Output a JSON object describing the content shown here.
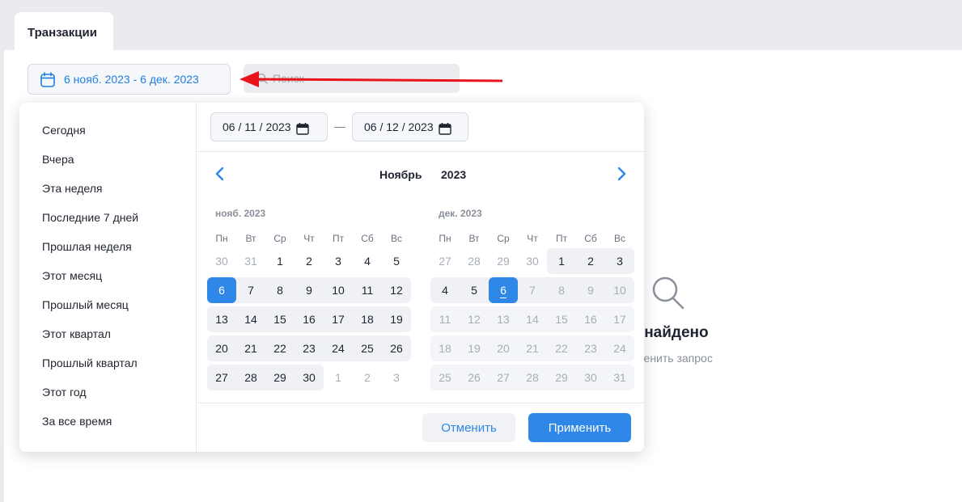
{
  "tab": {
    "label": "Транзакции"
  },
  "filter": {
    "date_range": "6 нояб. 2023 - 6 дек. 2023"
  },
  "search": {
    "placeholder": "Поиск"
  },
  "empty": {
    "title": "о не найдено",
    "subtitle": "е изменить запрос"
  },
  "presets": [
    "Сегодня",
    "Вчера",
    "Эта неделя",
    "Последние 7 дней",
    "Прошлая неделя",
    "Этот месяц",
    "Прошлый месяц",
    "Этот квартал",
    "Прошлый квартал",
    "Этот год",
    "За все время"
  ],
  "picker": {
    "start": "06 / 11 / 2023",
    "end": "06 / 12 / 2023",
    "month": "Ноябрь",
    "year": "2023",
    "weekdays": [
      "Пн",
      "Вт",
      "Ср",
      "Чт",
      "Пт",
      "Сб",
      "Вс"
    ],
    "months": [
      {
        "title": "нояб. 2023",
        "weeks": [
          [
            {
              "d": "30",
              "dim": true
            },
            {
              "d": "31",
              "dim": true
            },
            {
              "d": "1"
            },
            {
              "d": "2"
            },
            {
              "d": "3"
            },
            {
              "d": "4"
            },
            {
              "d": "5"
            }
          ],
          [
            {
              "d": "6",
              "sel": true,
              "range": true
            },
            {
              "d": "7",
              "range": true
            },
            {
              "d": "8",
              "range": true
            },
            {
              "d": "9",
              "range": true
            },
            {
              "d": "10",
              "range": true
            },
            {
              "d": "11",
              "range": true
            },
            {
              "d": "12",
              "range": true
            }
          ],
          [
            {
              "d": "13",
              "range": true
            },
            {
              "d": "14",
              "range": true
            },
            {
              "d": "15",
              "range": true
            },
            {
              "d": "16",
              "range": true
            },
            {
              "d": "17",
              "range": true
            },
            {
              "d": "18",
              "range": true
            },
            {
              "d": "19",
              "range": true
            }
          ],
          [
            {
              "d": "20",
              "range": true
            },
            {
              "d": "21",
              "range": true
            },
            {
              "d": "22",
              "range": true
            },
            {
              "d": "23",
              "range": true
            },
            {
              "d": "24",
              "range": true
            },
            {
              "d": "25",
              "range": true
            },
            {
              "d": "26",
              "range": true
            }
          ],
          [
            {
              "d": "27",
              "range": true
            },
            {
              "d": "28",
              "range": true
            },
            {
              "d": "29",
              "range": true
            },
            {
              "d": "30",
              "range": true
            },
            {
              "d": "1",
              "dim": true
            },
            {
              "d": "2",
              "dim": true
            },
            {
              "d": "3",
              "dim": true
            }
          ]
        ]
      },
      {
        "title": "дек. 2023",
        "weeks": [
          [
            {
              "d": "27",
              "dim": true
            },
            {
              "d": "28",
              "dim": true
            },
            {
              "d": "29",
              "dim": true
            },
            {
              "d": "30",
              "dim": true
            },
            {
              "d": "1",
              "range": true
            },
            {
              "d": "2",
              "range": true
            },
            {
              "d": "3",
              "range": true
            }
          ],
          [
            {
              "d": "4",
              "range": true
            },
            {
              "d": "5",
              "range": true
            },
            {
              "d": "6",
              "sel": true,
              "today": true,
              "range": true
            },
            {
              "d": "7",
              "dim": true,
              "out": true
            },
            {
              "d": "8",
              "dim": true,
              "out": true
            },
            {
              "d": "9",
              "dim": true,
              "out": true
            },
            {
              "d": "10",
              "dim": true,
              "out": true
            }
          ],
          [
            {
              "d": "11",
              "dim": true,
              "out": true
            },
            {
              "d": "12",
              "dim": true,
              "out": true
            },
            {
              "d": "13",
              "dim": true,
              "out": true
            },
            {
              "d": "14",
              "dim": true,
              "out": true
            },
            {
              "d": "15",
              "dim": true,
              "out": true
            },
            {
              "d": "16",
              "dim": true,
              "out": true
            },
            {
              "d": "17",
              "dim": true,
              "out": true
            }
          ],
          [
            {
              "d": "18",
              "dim": true,
              "out": true
            },
            {
              "d": "19",
              "dim": true,
              "out": true
            },
            {
              "d": "20",
              "dim": true,
              "out": true
            },
            {
              "d": "21",
              "dim": true,
              "out": true
            },
            {
              "d": "22",
              "dim": true,
              "out": true
            },
            {
              "d": "23",
              "dim": true,
              "out": true
            },
            {
              "d": "24",
              "dim": true,
              "out": true
            }
          ],
          [
            {
              "d": "25",
              "dim": true,
              "out": true
            },
            {
              "d": "26",
              "dim": true,
              "out": true
            },
            {
              "d": "27",
              "dim": true,
              "out": true
            },
            {
              "d": "28",
              "dim": true,
              "out": true
            },
            {
              "d": "29",
              "dim": true,
              "out": true
            },
            {
              "d": "30",
              "dim": true,
              "out": true
            },
            {
              "d": "31",
              "dim": true,
              "out": true
            }
          ]
        ]
      }
    ]
  },
  "buttons": {
    "cancel": "Отменить",
    "apply": "Применить"
  },
  "colors": {
    "accent": "#2f87e8",
    "range_bg": "#eff1f5",
    "arrow": "#e8141b"
  }
}
